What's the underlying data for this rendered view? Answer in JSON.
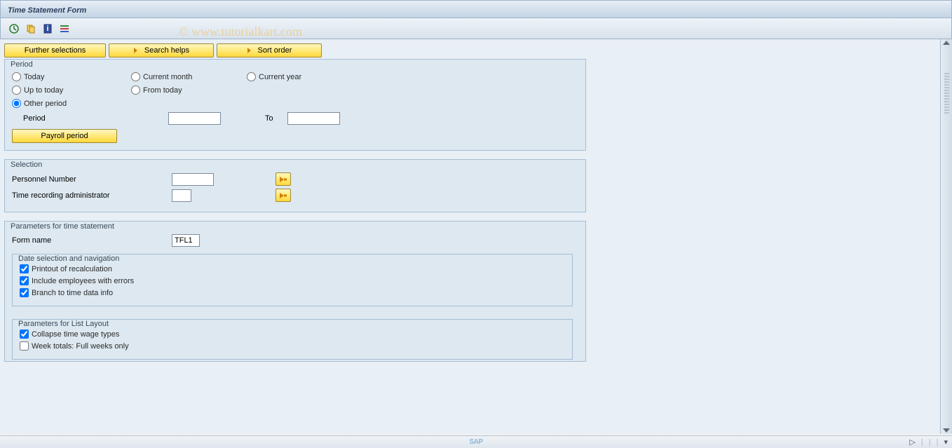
{
  "title": "Time Statement Form",
  "watermark": "© www.tutorialkart.com",
  "buttons": {
    "further_selections": "Further selections",
    "search_helps": "Search helps",
    "sort_order": "Sort order",
    "payroll_period": "Payroll period"
  },
  "period": {
    "title": "Period",
    "today": "Today",
    "up_to_today": "Up to today",
    "other_period": "Other period",
    "current_month": "Current month",
    "from_today": "From today",
    "current_year": "Current year",
    "period_label": "Period",
    "to_label": "To",
    "period_from": "",
    "period_to": ""
  },
  "selection": {
    "title": "Selection",
    "personnel_number": "Personnel Number",
    "personnel_number_value": "",
    "time_admin": "Time recording administrator",
    "time_admin_value": ""
  },
  "params": {
    "title": "Parameters for time statement",
    "form_name": "Form name",
    "form_name_value": "TFL1"
  },
  "date_nav": {
    "title": "Date selection and navigation",
    "printout": "Printout of recalculation",
    "include_errors": "Include employees with errors",
    "branch": "Branch to time data info"
  },
  "list_layout": {
    "title": "Parameters for List Layout",
    "collapse": "Collapse time wage types",
    "week_totals": "Week totals: Full weeks only"
  },
  "status": {
    "sap": "SAP"
  }
}
